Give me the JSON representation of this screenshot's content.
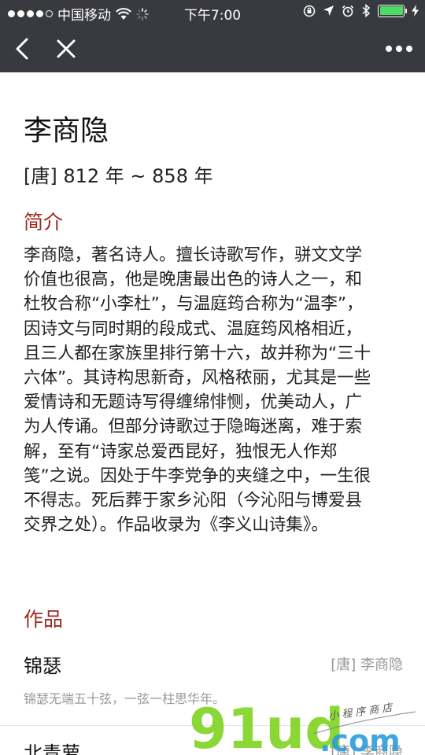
{
  "status_bar": {
    "carrier": "中国移动",
    "time": "下午7:00"
  },
  "nav": {
    "back_icon": "chevron-left-icon",
    "close_icon": "close-icon",
    "more_icon": "more-horizontal-icon"
  },
  "poet": {
    "name": "李商隐",
    "dates": "[唐] 812 年 ~ 858 年"
  },
  "intro": {
    "title": "简介",
    "lines": [
      "李商隐，著名诗人。擅长诗歌写作，骈文文学",
      "价值也很高，他是晚唐最出色的诗人之一，和",
      "杜牧合称“小李杜”，与温庭筠合称为“温李”，",
      "因诗文与同时期的段成式、温庭筠风格相近，",
      "且三人都在家族里排行第十六，故并称为“三十",
      "六体”。其诗构思新奇，风格秾丽，尤其是一些",
      "爱情诗和无题诗写得缠绵悱恻，优美动人，广",
      "为人传诵。但部分诗歌过于隐晦迷离，难于索",
      "解，至有“诗家总爱西昆好，独恨无人作郑",
      "笺”之说。因处于牛李党争的夹缝之中，一生很",
      "不得志。死后葬于家乡沁阳（今沁阳与博爱县",
      "交界之处）。作品收录为《李义山诗集》。"
    ]
  },
  "works": {
    "title": "作品",
    "items": [
      {
        "title": "锦瑟",
        "author": "[唐] 李商隐",
        "excerpt": "锦瑟无端五十弦，一弦一柱思华年。"
      },
      {
        "title": "北青萝",
        "author": "[唐] 李商隐"
      }
    ]
  },
  "watermark": {
    "brand": "91ud",
    "domain": ".com",
    "tagline": "小程序商店"
  },
  "colors": {
    "bar_bg": "#393a3f",
    "accent": "#9b2b22",
    "battery": "#4cd964",
    "watermark_green": "#7ed321",
    "watermark_blue": "#2d9cdb"
  }
}
